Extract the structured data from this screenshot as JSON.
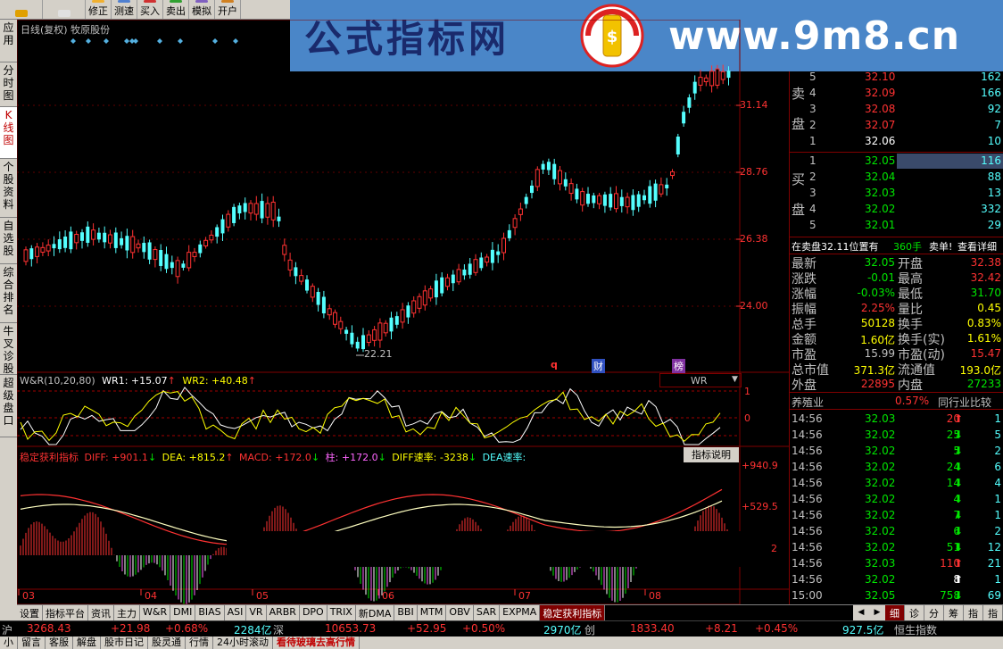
{
  "toolbar": {
    "buttons": [
      {
        "label": "",
        "icon": "back-arrow-icon"
      },
      {
        "label": "",
        "icon": "page-icon"
      },
      {
        "label": "修正",
        "icon": "down-arrow-icon"
      },
      {
        "label": "测速",
        "icon": "speed-icon"
      },
      {
        "label": "买入",
        "icon": "buy-icon"
      },
      {
        "label": "卖出",
        "icon": "sell-icon"
      },
      {
        "label": "模拟",
        "icon": "sim-icon"
      },
      {
        "label": "开户",
        "icon": "account-icon"
      }
    ]
  },
  "banner": {
    "title": "公式指标网",
    "logo_text": "公式指标网",
    "url": "www.9m8.cn"
  },
  "left_tabs": [
    {
      "label": "应用",
      "active": false
    },
    {
      "label": "分时图",
      "active": false
    },
    {
      "label": "K线图",
      "active": true
    },
    {
      "label": "个股资料",
      "active": false
    },
    {
      "label": "自选股",
      "active": false
    },
    {
      "label": "综合排名",
      "active": false
    },
    {
      "label": "牛叉诊股",
      "active": false
    },
    {
      "label": "超级盘口",
      "active": false
    }
  ],
  "chart": {
    "header": "日线(复权)  牧原股份",
    "price_axis": [
      "31.14",
      "28.76",
      "26.38",
      "24.00"
    ],
    "low_label": "22.21",
    "markers": [
      "q",
      "财",
      "榜"
    ],
    "wr_header": {
      "name": "W&R(10,20,80)",
      "wr1": "WR1: +15.07",
      "wr1_arrow": "↑",
      "wr2": "WR2: +40.48",
      "wr2_arrow": "↑"
    },
    "wr_axis": [
      "1",
      "0"
    ],
    "wr_select": "WR",
    "macd_header": {
      "name": "稳定获利指标",
      "diff": "DIFF: +901.1",
      "diff_arrow": "↓",
      "dea": "DEA: +815.2",
      "dea_arrow": "↑",
      "macd": "MACD: +172.0",
      "macd_arrow": "↓",
      "zhu": "柱: +172.0",
      "zhu_arrow": "↓",
      "diff_speed": "DIFF速率: -3238",
      "diff_speed_arrow": "↓",
      "dea_speed": "DEA速率:"
    },
    "macd_button": "指标说明",
    "macd_axis": [
      "+940.9",
      "+529.5",
      "2"
    ],
    "months": [
      "03",
      "04",
      "05",
      "06",
      "07",
      "08"
    ]
  },
  "order_book": {
    "sell_label": "卖盘",
    "buy_label": "买盘",
    "asks": [
      {
        "level": "5",
        "price": "32.10",
        "vol": "162"
      },
      {
        "level": "4",
        "price": "32.09",
        "vol": "166"
      },
      {
        "level": "3",
        "price": "32.08",
        "vol": "92"
      },
      {
        "level": "2",
        "price": "32.07",
        "vol": "7"
      },
      {
        "level": "1",
        "price": "32.06",
        "vol": "10"
      }
    ],
    "bids": [
      {
        "level": "1",
        "price": "32.05",
        "vol": "116"
      },
      {
        "level": "2",
        "price": "32.04",
        "vol": "88"
      },
      {
        "level": "3",
        "price": "32.03",
        "vol": "13"
      },
      {
        "level": "4",
        "price": "32.02",
        "vol": "332"
      },
      {
        "level": "5",
        "price": "32.01",
        "vol": "29"
      }
    ],
    "notice_a": "在卖盘32.11位置有",
    "notice_b": "360手",
    "notice_c": "卖单!",
    "notice_d": "查看详细"
  },
  "quote": [
    {
      "l1": "最新",
      "v1": "32.05",
      "l2": "开盘",
      "v2": "32.38"
    },
    {
      "l1": "涨跌",
      "v1": "-0.01",
      "l2": "最高",
      "v2": "32.42"
    },
    {
      "l1": "涨幅",
      "v1": "-0.03%",
      "l2": "最低",
      "v2": "31.70"
    },
    {
      "l1": "振幅",
      "v1": "2.25%",
      "l2": "量比",
      "v2": "0.45"
    },
    {
      "l1": "总手",
      "v1": "50128",
      "l2": "换手",
      "v2": "0.83%"
    },
    {
      "l1": "金额",
      "v1": "1.60亿",
      "l2": "换手(实)",
      "v2": "1.61%"
    },
    {
      "l1": "市盈",
      "v1": "15.99",
      "l2": "市盈(动)",
      "v2": "15.47"
    },
    {
      "l1": "总市值",
      "v1": "371.3亿",
      "l2": "流通值",
      "v2": "193.0亿"
    },
    {
      "l1": "外盘",
      "v1": "22895",
      "l2": "内盘",
      "v2": "27233"
    }
  ],
  "sector": {
    "name": "养殖业",
    "pct": "0.57%",
    "compare": "同行业比较"
  },
  "ticks": [
    {
      "time": "14:56",
      "price": "32.03",
      "vol": "20",
      "dir": "up",
      "n": "1"
    },
    {
      "time": "14:56",
      "price": "32.02",
      "vol": "25",
      "dir": "down",
      "n": "5"
    },
    {
      "time": "14:56",
      "price": "32.02",
      "vol": "5",
      "dir": "down",
      "n": "2"
    },
    {
      "time": "14:56",
      "price": "32.02",
      "vol": "24",
      "dir": "down",
      "n": "6"
    },
    {
      "time": "14:56",
      "price": "32.02",
      "vol": "14",
      "dir": "down",
      "n": "4"
    },
    {
      "time": "14:56",
      "price": "32.02",
      "vol": "4",
      "dir": "down",
      "n": "1"
    },
    {
      "time": "14:56",
      "price": "32.02",
      "vol": "7",
      "dir": "down",
      "n": "1"
    },
    {
      "time": "14:56",
      "price": "32.02",
      "vol": "6",
      "dir": "down",
      "n": "2"
    },
    {
      "time": "14:56",
      "price": "32.02",
      "vol": "51",
      "dir": "down",
      "n": "12"
    },
    {
      "time": "14:56",
      "price": "32.03",
      "vol": "110",
      "dir": "up",
      "n": "21"
    },
    {
      "time": "14:56",
      "price": "32.02",
      "vol": "8",
      "dir": "white",
      "n": "1"
    },
    {
      "time": "15:00",
      "price": "32.05",
      "vol": "758",
      "dir": "down",
      "n": "69"
    }
  ],
  "bottom_tabs": [
    "设置",
    "指标平台",
    "资讯",
    "主力",
    "W&R",
    "DMI",
    "BIAS",
    "ASI",
    "VR",
    "ARBR",
    "DPO",
    "TRIX",
    "新DMA",
    "BBI",
    "MTM",
    "OBV",
    "SAR",
    "EXPMA",
    "稳定获利指标"
  ],
  "bottom_active": "稳定获利指标",
  "right_tabs": [
    "细",
    "诊",
    "分",
    "筹",
    "指",
    "指"
  ],
  "ticker": {
    "sh_label": "沪",
    "sh_index": "3268.43",
    "sh_change": "+21.98",
    "sh_pct": "+0.68%",
    "sh_amount": "2284亿",
    "sz_label": "深",
    "sz_index": "10653.73",
    "sz_change": "+52.95",
    "sz_pct": "+0.50%",
    "sz_amount": "2970亿",
    "cy_label": "创",
    "cy_index": "1833.40",
    "cy_change": "+8.21",
    "cy_pct": "+0.45%",
    "hk_amount": "927.5亿",
    "hk_label": "恒生指数"
  },
  "status": [
    "小",
    "留言",
    "客服",
    "解盘",
    "股市日记",
    "股灵通",
    "行情",
    "24小时滚动",
    "看待玻璃去高行情"
  ],
  "colors": {
    "up": "#ff3232",
    "down": "#54ffff",
    "yellow": "#ffff00",
    "green": "#00e600",
    "purple": "#ff66ff"
  }
}
